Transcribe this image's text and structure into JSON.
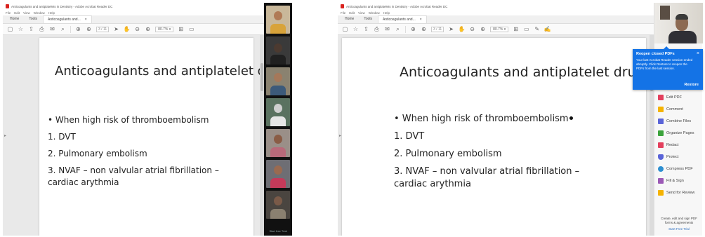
{
  "acrobat": {
    "window_title": "Anticoagulants and antiplatelets in Dentistry - Adobe Acrobat Reader DC",
    "menu": [
      "File",
      "Edit",
      "View",
      "Window",
      "Help"
    ],
    "tabs": {
      "home": "Home",
      "tools": "Tools",
      "document": "Anticoagulants and...",
      "close": "×"
    },
    "toolbar": {
      "page_display": "3 / 11",
      "zoom": "80.7% ▾"
    }
  },
  "slide": {
    "title": "Anticoagulants and antiplatelet drugs",
    "lines": [
      "• When high risk of thromboembolism",
      "1.  DVT",
      "2.  Pulmonary embolism",
      "3.  NVAF – non valvular atrial fibrillation –",
      "      cardiac arythmia"
    ]
  },
  "participants": {
    "footer": "Start free Trial"
  },
  "popup": {
    "title": "Reopen closed PDFs",
    "body": "Your last Acrobat Reader session ended abruptly. Click Restore to reopen the PDFs from the last session.",
    "restore": "Restore",
    "close": "×"
  },
  "tools_panel": {
    "items": [
      {
        "label": "Edit PDF",
        "color": "#e3405d"
      },
      {
        "label": "Comment",
        "color": "#f5b301"
      },
      {
        "label": "Combine Files",
        "color": "#5a64d8"
      },
      {
        "label": "Organize Pages",
        "color": "#3ca33c"
      },
      {
        "label": "Redact",
        "color": "#e3405d"
      },
      {
        "label": "Protect",
        "color": "#5a64d8"
      },
      {
        "label": "Compress PDF",
        "color": "#2d8fd0"
      },
      {
        "label": "Fill & Sign",
        "color": "#9b59b6"
      },
      {
        "label": "Send for Review",
        "color": "#f5b301"
      }
    ],
    "footer": "Create, edit and sign PDF forms & agreements",
    "footer_link": "Start Free Trial"
  },
  "colors": {
    "accent": "#1473e6",
    "acrobat_red": "#d9231f"
  }
}
